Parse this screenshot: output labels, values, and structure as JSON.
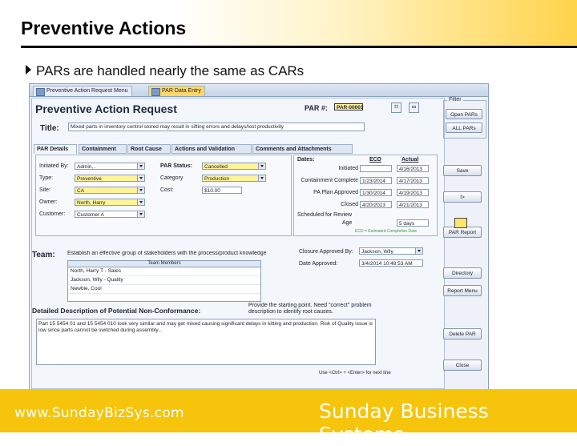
{
  "slide": {
    "title": "Preventive Actions",
    "bullet": "PARs are handled nearly the same as CARs",
    "website": "www.SundayBizSys.com",
    "company": "Sunday Business Systems"
  },
  "window": {
    "tabs": [
      "Preventive Action Request Menu",
      "PAR Data Entry"
    ],
    "form_title": "Preventive Action Request",
    "par_label": "PAR #:",
    "par_value": "PAR-00001",
    "title_label": "Title:",
    "title_value": "Mixed parts in inventory control stored may result in sifting errors and delays/lost productivity",
    "form_tabs": [
      "PAR Details",
      "Containment",
      "Root Cause",
      "Actions and Validation",
      "Comments and Attachments"
    ],
    "details": {
      "initiated_by": {
        "label": "Initiated By:",
        "value": "Admin, ."
      },
      "type": {
        "label": "Type:",
        "value": "Preventive"
      },
      "site": {
        "label": "Site:",
        "value": "CA"
      },
      "owner": {
        "label": "Owner:",
        "value": "North, Harry"
      },
      "customer": {
        "label": "Customer:",
        "value": "Customer A"
      },
      "par_status": {
        "label": "PAR Status:",
        "value": "Cancelled"
      },
      "category": {
        "label": "Category",
        "value": "Production"
      },
      "cost": {
        "label": "Cost:",
        "value": "$10.00"
      }
    },
    "dates": {
      "header": "Dates:",
      "col_ecd": "ECD",
      "col_actual": "Actual",
      "rows": [
        {
          "label": "Initiated",
          "ecd": "",
          "actual": "4/16/2013"
        },
        {
          "label": "Containment Complete",
          "ecd": "1/23/2014",
          "actual": "4/17/2013"
        },
        {
          "label": "PA Plan Approved",
          "ecd": "1/30/2014",
          "actual": "4/19/2013"
        },
        {
          "label": "Closed",
          "ecd": "4/20/2013",
          "actual": "4/21/2013"
        }
      ],
      "scheduled_label": "Scheduled for Review",
      "age_label": "Age",
      "age_value": "5 days",
      "legend": "ECD = Estimated Completion Date"
    },
    "team": {
      "label": "Team:",
      "description": "Establish an effective group of stakeholders with the process/product knowledge",
      "grid_header": "Team Members",
      "members": [
        "North, Harry T - Sales",
        "Jackson, Wily - Quality",
        "Newbie, Cool"
      ]
    },
    "closure": {
      "approved_by_label": "Closure Approved By:",
      "approved_by_value": "Jackson, Wily",
      "date_label": "Date Approved:",
      "date_value": "3/4/2014 10:48:53 AM"
    },
    "hint": "Provide the starting point. Need \"correct\" problem description to identify root causes.",
    "nonconformance_label": "Detailed Description of Potential Non-Conformance:",
    "nonconformance_text": "Part 15 5454 01 and 15 5454 010 look very similar and may get mixed causing significant delays in kitting and production. Risk of Quality issue is low since parts cannot be switched during assembly...",
    "footer_hint": "Use <Ctrl> + <Enter> for next line",
    "buttons": {
      "filters": "Filter",
      "open_pars": "Open PARs",
      "all_pars": "ALL PARs",
      "save": "Save",
      "next": "I>",
      "par_report": "PAR Report",
      "directory": "Directory",
      "report_menu": "Report Menu",
      "delete_par": "Delete PAR",
      "close": "Close"
    }
  }
}
